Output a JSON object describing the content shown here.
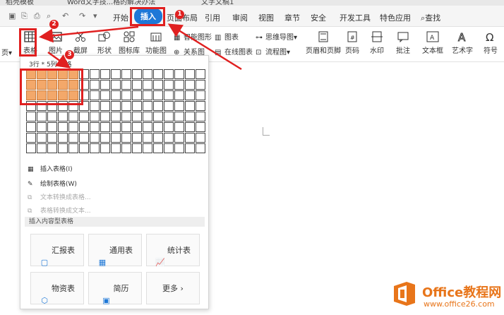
{
  "titlebar": {
    "tabs": [
      "稻壳模板",
      "Word文字技...格的解决办法",
      "文字文稿1"
    ]
  },
  "menu": {
    "tabs": [
      "开始",
      "插入",
      "页面布局",
      "引用",
      "审阅",
      "视图",
      "章节",
      "安全",
      "开发工具",
      "特色应用"
    ],
    "active_tab": "插入",
    "search_label": "查找"
  },
  "toolbar": {
    "page": "页",
    "table": "表格",
    "picture": "图片",
    "screenshot": "截屏",
    "shape": "形状",
    "icon_lib": "图标库",
    "func_chart": "功能图",
    "smart_shape": "智能图形",
    "chart": "图表",
    "mind_map": "思维导图",
    "relation": "关系图",
    "online_chart": "在线图表",
    "flowchart": "流程图",
    "header_footer": "页眉和页脚",
    "page_number": "页码",
    "watermark": "水印",
    "annotation": "批注",
    "textbox": "文本框",
    "wordart": "艺术字",
    "symbol": "符号"
  },
  "table_panel": {
    "size_label": "3行 * 5列 表格",
    "rows": 8,
    "cols": 17,
    "selected_rows": 3,
    "selected_cols": 5,
    "items": [
      {
        "label": "插入表格(I)",
        "enabled": true
      },
      {
        "label": "绘制表格(W)",
        "enabled": true
      },
      {
        "label": "文本转换成表格...",
        "enabled": false
      },
      {
        "label": "表格转换成文本...",
        "enabled": false
      }
    ],
    "section_title": "插入内容型表格",
    "cards": [
      "汇报表",
      "通用表",
      "统计表",
      "物资表",
      "简历",
      "更多"
    ]
  },
  "annotations": [
    "1",
    "2",
    "3"
  ],
  "watermark": {
    "brand": "Office教程网",
    "url": "www.office26.com"
  },
  "colors": {
    "accent": "#1e78d7",
    "annotation": "#e02020",
    "grid_selected": "#f3a86a",
    "watermark": "#e8751a"
  }
}
